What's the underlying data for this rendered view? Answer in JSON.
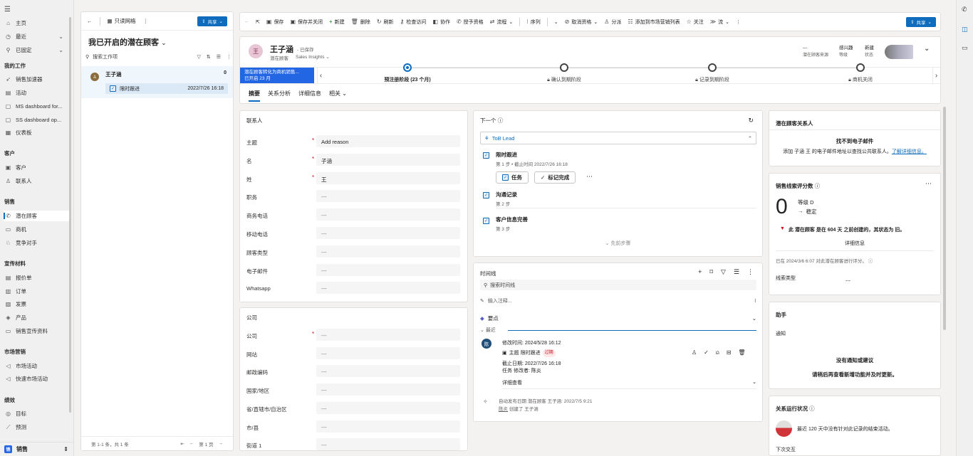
{
  "nav": {
    "items_top": [
      "主页",
      "最近",
      "已固定"
    ],
    "section_work": "我的工作",
    "work_items": [
      "销售加速器",
      "活动",
      "MS dashboard for...",
      "SS dashboard op...",
      "仪表板"
    ],
    "section_customers": "客户",
    "customer_items": [
      "客户",
      "联系人"
    ],
    "section_sales": "销售",
    "sales_items": [
      "潜在顾客",
      "商机",
      "竞争对手"
    ],
    "section_collateral": "宣传材料",
    "collateral_items": [
      "报价单",
      "订单",
      "发票",
      "产品",
      "销售宣传资料"
    ],
    "section_marketing": "市场营销",
    "marketing_items": [
      "市场活动",
      "快速市场活动"
    ],
    "section_performance": "绩效",
    "performance_items": [
      "目标",
      "预测"
    ],
    "bottom_badge": "销",
    "bottom_label": "销售"
  },
  "list": {
    "readonly_grid": "只读网格",
    "share": "共享",
    "title": "我已开启的潜在顾客",
    "search_placeholder": "搜索工作项",
    "record_name": "王子涵",
    "record_count": "0",
    "task_name": "限时跟进",
    "task_date": "2022/7/26 16:18",
    "footer_count": "第 1-1 条，共 1 条",
    "footer_page": "第 1 页"
  },
  "commands": [
    "保存",
    "保存并关闭",
    "新建",
    "删除",
    "刷新",
    "检查访问",
    "协作",
    "授予资格",
    "流程",
    "序列",
    "取消资格",
    "分派",
    "添加到市场营销列表",
    "关注",
    "流"
  ],
  "command_share": "共享",
  "header": {
    "avatar": "王",
    "name": "王子涵",
    "saved": "- 已保存",
    "entity": "潜在顾客",
    "app": "Sales Insights",
    "source_value": "---",
    "source_label": "潜在顾客来源",
    "rating_value": "感兴趣",
    "rating_label": "等级",
    "status_value": "新建",
    "status_label": "状态"
  },
  "bpf": {
    "active_title": "潜在顾客转化为商机销售...",
    "active_sub": "已开启 23 月",
    "stages": [
      "预注册阶段 (23 个月)",
      "确认到期阶段",
      "记录到期阶段",
      "商机关闭"
    ]
  },
  "tabs": [
    "摘要",
    "关系分析",
    "详细信息",
    "相关"
  ],
  "contact": {
    "title": "联系人",
    "fields": [
      {
        "label": "主题",
        "value": "Add reason",
        "req": "*"
      },
      {
        "label": "名",
        "value": "子涵",
        "req": "*"
      },
      {
        "label": "姓",
        "value": "王",
        "req": "*"
      },
      {
        "label": "职务",
        "value": "---",
        "req": ""
      },
      {
        "label": "商务电话",
        "value": "---",
        "req": ""
      },
      {
        "label": "移动电话",
        "value": "---",
        "req": ""
      },
      {
        "label": "顾客类型",
        "value": "---",
        "req": ""
      },
      {
        "label": "电子邮件",
        "value": "---",
        "req": ""
      },
      {
        "label": "Whatsapp",
        "value": "---",
        "req": ""
      }
    ]
  },
  "company": {
    "title": "公司",
    "fields": [
      {
        "label": "公司",
        "value": "---",
        "req": "*"
      },
      {
        "label": "网站",
        "value": "---",
        "req": ""
      },
      {
        "label": "邮政编码",
        "value": "---",
        "req": ""
      },
      {
        "label": "国家/地区",
        "value": "---",
        "req": ""
      },
      {
        "label": "省/直辖市/自治区",
        "value": "---",
        "req": ""
      },
      {
        "label": "市/县",
        "value": "---",
        "req": ""
      },
      {
        "label": "街道 1",
        "value": "---",
        "req": ""
      }
    ]
  },
  "next": {
    "title": "下一个",
    "sequence": "ToB Lead",
    "step1_title": "限时跟进",
    "step1_sub": "第 1 步 • 截止时间 2022/7/26 16:18",
    "task_btn": "任务",
    "complete_btn": "标记完成",
    "step2_title": "沟通记录",
    "step2_sub": "第 2 步",
    "step3_title": "客户信息完善",
    "step3_sub": "第 3 步",
    "prev_steps": "先前步骤"
  },
  "timeline": {
    "title": "时间线",
    "search": "搜索时间线",
    "note": "输入注释...",
    "highlights": "要点",
    "recent": "最近",
    "entry_avatar": "陈",
    "entry_modified": "修改时间: 2024/5/28 16:12",
    "entry_subject": "主题 限时跟进",
    "entry_tag": "过期",
    "entry_due": "截止日期: 2022/7/26 16:18",
    "entry_modifier": "任务 修改者: 陈炎",
    "entry_details": "详细查看",
    "auto_line1": "自动发布日期 潜在顾客 王子涵:  2022/7/5 9:21",
    "auto_user": "陈炎",
    "auto_line2": "创建了 王子涵"
  },
  "right": {
    "contacts_title": "潜在顾客关系人",
    "no_email": "找不到电子邮件",
    "add_email": "添加 子涵 王 的电子邮件地址以查找公共联系人。",
    "learn_more": "了解详细信息。",
    "score_title": "销售线索评分数",
    "score": "0",
    "grade": "等级 D",
    "trend": "稳定",
    "age_text": "此 潜在顾客 是在 604 天 之前创建的，其状态为 旧。",
    "details": "详细信息",
    "scored_at": "已在 2024/3/6 6:07 对此潜在顾客进行评分。",
    "lead_type_label": "线索类型",
    "lead_type_value": "---",
    "assistant_title": "助手",
    "notify": "通知",
    "no_notify": "没有通知或建议",
    "check_later": "请稍后再查看新增功能并及时更新。",
    "health_title": "关系运行状况",
    "health_text": "最近 120 天中没有针对此记录的结束活动。",
    "next_interaction": "下次交互"
  }
}
